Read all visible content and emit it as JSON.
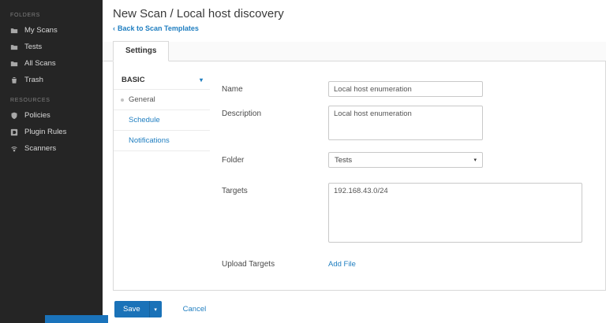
{
  "colors": {
    "accent": "#1f7ec0",
    "save_button": "#1a72b8",
    "sidebar_bg": "#252525"
  },
  "sidebar": {
    "sections": [
      {
        "label": "FOLDERS",
        "items": [
          {
            "label": "My Scans",
            "icon": "folder-icon"
          },
          {
            "label": "Tests",
            "icon": "folder-icon"
          },
          {
            "label": "All Scans",
            "icon": "folder-icon"
          },
          {
            "label": "Trash",
            "icon": "trash-icon"
          }
        ]
      },
      {
        "label": "RESOURCES",
        "items": [
          {
            "label": "Policies",
            "icon": "policies-icon"
          },
          {
            "label": "Plugin Rules",
            "icon": "plugin-rules-icon"
          },
          {
            "label": "Scanners",
            "icon": "scanners-icon"
          }
        ]
      }
    ]
  },
  "header": {
    "title": "New Scan / Local host discovery",
    "back_arrow": "‹",
    "back_label": "Back to Scan Templates"
  },
  "tabs": {
    "settings": "Settings"
  },
  "settings_nav": {
    "group_label": "BASIC",
    "chevron": "▾",
    "items": [
      {
        "label": "General",
        "active": true
      },
      {
        "label": "Schedule",
        "active": false
      },
      {
        "label": "Notifications",
        "active": false
      }
    ]
  },
  "form": {
    "name_label": "Name",
    "name_value": "Local host enumeration",
    "description_label": "Description",
    "description_value": "Local host enumeration",
    "folder_label": "Folder",
    "folder_value": "Tests",
    "folder_caret": "▾",
    "targets_label": "Targets",
    "targets_value": "192.168.43.0/24",
    "upload_label": "Upload Targets",
    "upload_link": "Add File"
  },
  "footer": {
    "save_label": "Save",
    "save_caret": "▾",
    "cancel_label": "Cancel"
  }
}
